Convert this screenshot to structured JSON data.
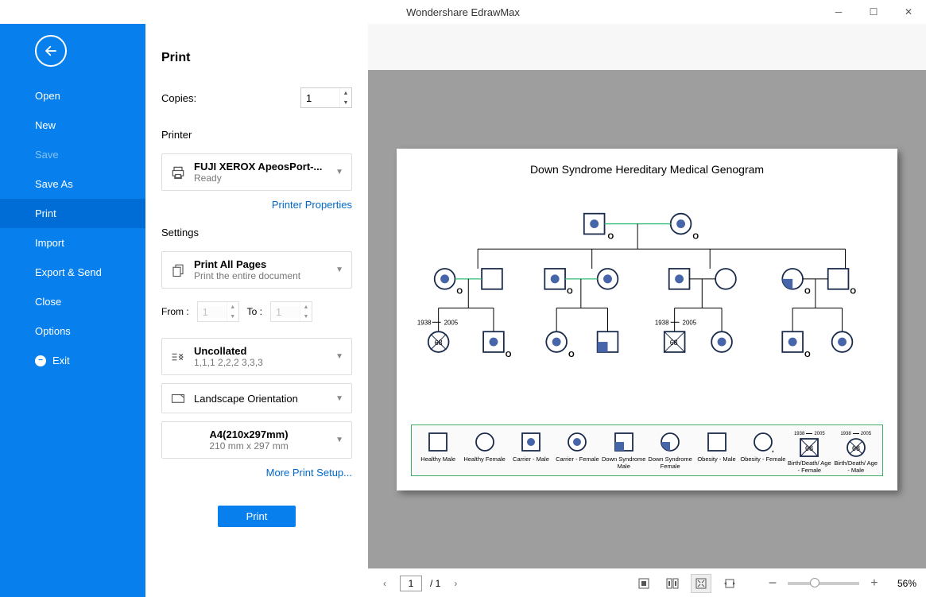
{
  "app": {
    "title": "Wondershare EdrawMax"
  },
  "sidebar": {
    "items": [
      {
        "label": "Open"
      },
      {
        "label": "New"
      },
      {
        "label": "Save"
      },
      {
        "label": "Save As"
      },
      {
        "label": "Print"
      },
      {
        "label": "Import"
      },
      {
        "label": "Export & Send"
      },
      {
        "label": "Close"
      },
      {
        "label": "Options"
      },
      {
        "label": "Exit"
      }
    ]
  },
  "print": {
    "heading": "Print",
    "copies_label": "Copies:",
    "copies_value": "1",
    "printer_label": "Printer",
    "printer_name": "FUJI XEROX ApeosPort-...",
    "printer_status": "Ready",
    "properties_link": "Printer Properties",
    "settings_label": "Settings",
    "pages_title": "Print All Pages",
    "pages_sub": "Print the entire document",
    "from_label": "From :",
    "from_value": "1",
    "to_label": "To :",
    "to_value": "1",
    "collate_title": "Uncollated",
    "collate_sub": "1,1,1   2,2,2   3,3,3",
    "orientation": "Landscape Orientation",
    "paper_title": "A4(210x297mm)",
    "paper_sub": "210 mm x 297 mm",
    "more_link": "More Print Setup...",
    "button": "Print"
  },
  "preview": {
    "doc_title": "Down Syndrome Hereditary Medical Genogram",
    "legend": [
      "Healthy Male",
      "Healthy Female",
      "Carrier - Male",
      "Carrier - Female",
      "Down Syndrome Male",
      "Down Syndrome Female",
      "Obesity - Male",
      "Obesity - Female",
      "Birth/Death/ Age - Female",
      "Birth/Death/ Age - Male"
    ],
    "bd_left": "1938",
    "bd_right": "2005",
    "bd_age": "68",
    "legend_year_left": "1938",
    "legend_year_right": "2005",
    "legend_age": "68"
  },
  "status": {
    "page_value": "1",
    "page_total": "/ 1",
    "zoom": "56%"
  }
}
